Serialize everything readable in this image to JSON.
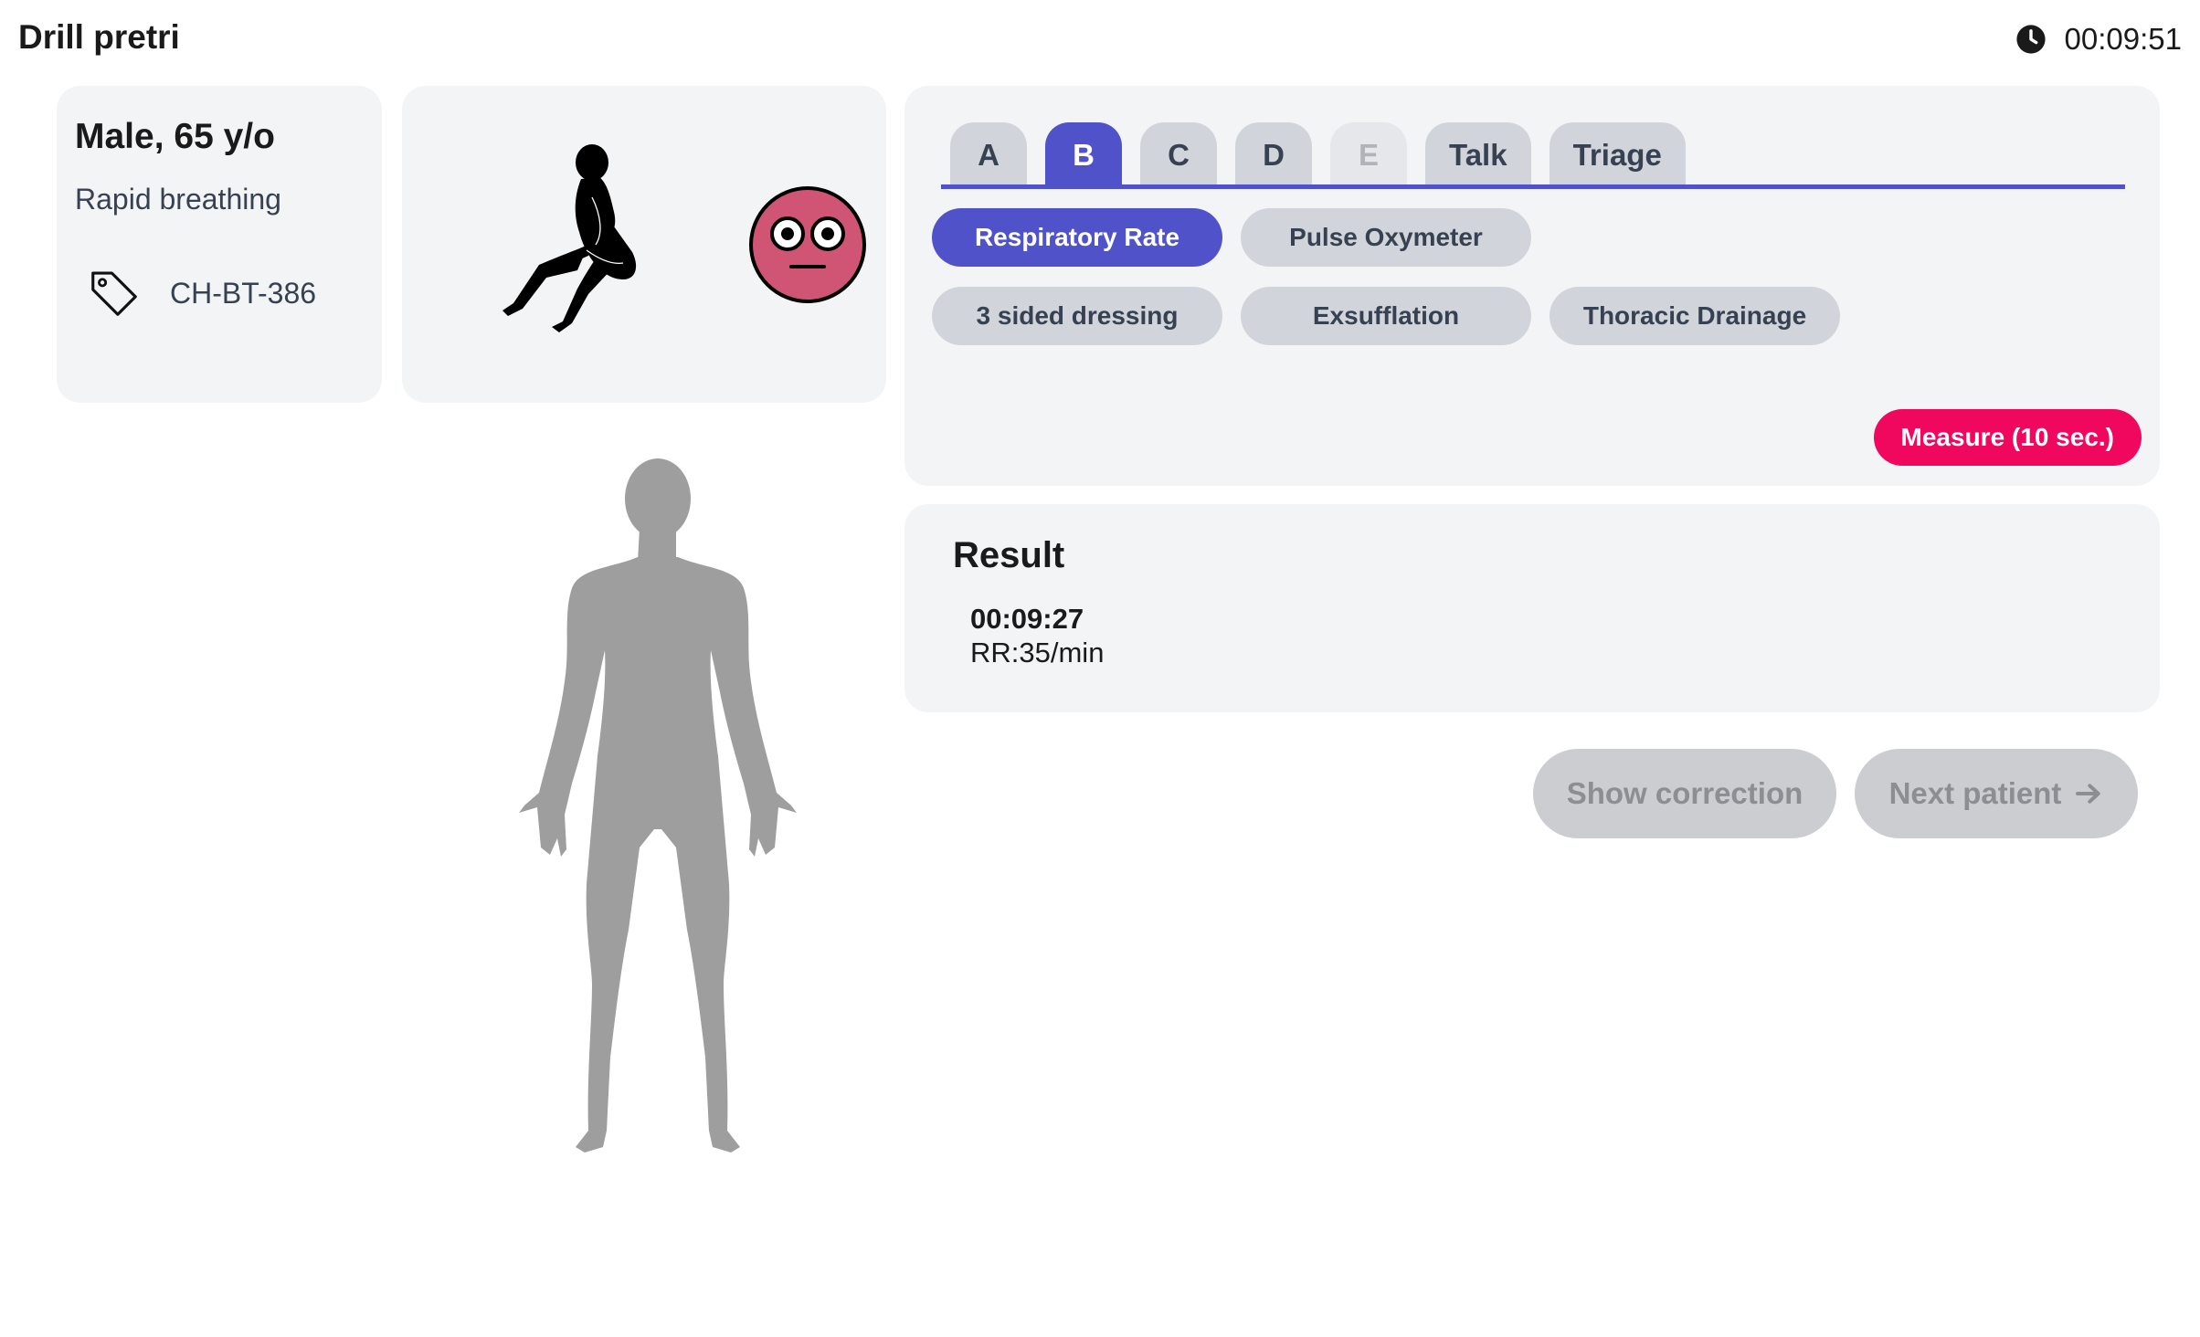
{
  "header": {
    "title": "Drill pretri",
    "timer": "00:09:51"
  },
  "patient": {
    "name": "Male, 65 y/o",
    "symptom": "Rapid breathing",
    "tag_code": "CH-BT-386"
  },
  "tabs": [
    {
      "label": "A",
      "state": "inactive"
    },
    {
      "label": "B",
      "state": "active"
    },
    {
      "label": "C",
      "state": "inactive"
    },
    {
      "label": "D",
      "state": "inactive"
    },
    {
      "label": "E",
      "state": "disabled"
    },
    {
      "label": "Talk",
      "state": "inactive"
    },
    {
      "label": "Triage",
      "state": "inactive"
    }
  ],
  "actions": [
    {
      "label": "Respiratory Rate",
      "state": "active"
    },
    {
      "label": "Pulse Oxymeter",
      "state": "inactive"
    },
    {
      "label": "3 sided dressing",
      "state": "inactive"
    },
    {
      "label": "Exsufflation",
      "state": "inactive"
    },
    {
      "label": "Thoracic Drainage",
      "state": "inactive"
    }
  ],
  "measure_button": "Measure (10 sec.)",
  "result": {
    "title": "Result",
    "time": "00:09:27",
    "value": "RR:35/min"
  },
  "buttons": {
    "show_correction": "Show correction",
    "next_patient": "Next patient"
  },
  "colors": {
    "accent": "#4f52c9",
    "measure": "#f0085f",
    "face": "#d05574",
    "card_bg": "#f3f4f6",
    "pill_bg": "#d1d5db",
    "body_silhouette": "#9e9e9e"
  },
  "icons": [
    "clock-icon",
    "tag-icon",
    "sitting-pose-icon",
    "worried-face-icon",
    "arrow-right-icon"
  ]
}
